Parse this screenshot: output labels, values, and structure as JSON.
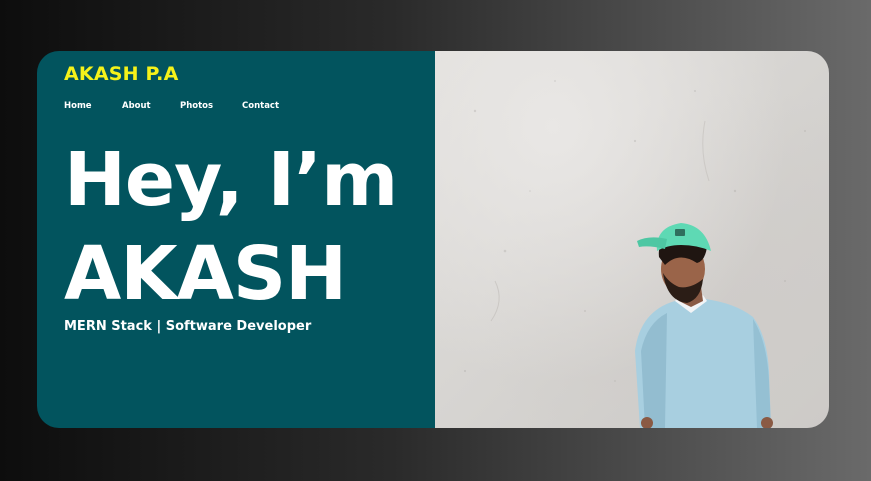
{
  "header": {
    "brand": "AKASH P.A"
  },
  "nav": {
    "items": [
      "Home",
      "About",
      "Photos",
      "Contact"
    ]
  },
  "hero": {
    "line1": "Hey, I’m",
    "line2": "AKASH",
    "tagline": "MERN Stack | Software Developer"
  },
  "colors": {
    "panel": "#02545e",
    "brand": "#f5f21a",
    "text": "#ffffff",
    "cap": "#5ed9b4",
    "sweater": "#a8cfe0"
  },
  "photo": {
    "icon": "person-photo"
  }
}
